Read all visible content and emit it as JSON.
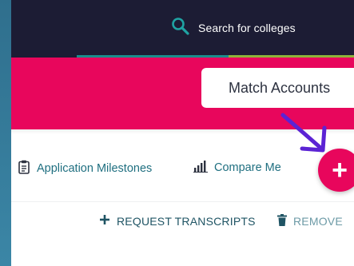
{
  "search": {
    "label": "Search for colleges",
    "icon": "search-icon"
  },
  "banner": {
    "match_label": "Match Accounts",
    "color": "#e8065c"
  },
  "actions": {
    "milestones_label": "Application Milestones",
    "milestones_icon": "clipboard-icon",
    "compare_label": "Compare Me",
    "compare_icon": "bar-chart-icon",
    "fab_label": "+"
  },
  "transcripts": {
    "request_label": "REQUEST TRANSCRIPTS",
    "request_icon": "plus-icon",
    "remove_label": "REMOVE",
    "remove_icon": "trash-icon"
  },
  "colors": {
    "topbar": "#1c1c34",
    "accent": "#e8065c",
    "link": "#1f6f80"
  }
}
